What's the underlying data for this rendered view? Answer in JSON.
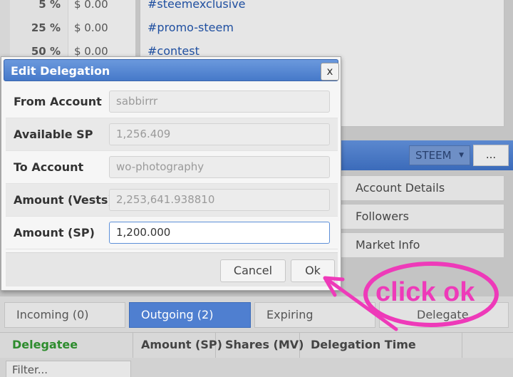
{
  "background": {
    "percent_rows": [
      {
        "pct": "5 %",
        "usd": "$ 0.00"
      },
      {
        "pct": "25 %",
        "usd": "$ 0.00"
      },
      {
        "pct": "50 %",
        "usd": "$ 0.00"
      }
    ],
    "tags": [
      "#steemexclusive",
      "#promo-steem",
      "#contest"
    ],
    "currency": {
      "selected": "STEEM",
      "more_label": "..."
    },
    "menu": [
      "Account Details",
      "Followers",
      "Market Info"
    ],
    "tabs": [
      "Incoming (0)",
      "Outgoing (2)",
      "Expiring",
      "Delegate"
    ],
    "table": {
      "headers": [
        "Delegatee",
        "Amount (SP)",
        "Shares (MV)",
        "Delegation Time"
      ],
      "filter_placeholder": "Filter..."
    }
  },
  "dialog": {
    "title": "Edit Delegation",
    "close_label": "x",
    "fields": [
      {
        "label": "From Account",
        "value": "sabbirrr"
      },
      {
        "label": "Available SP",
        "value": "1,256.409"
      },
      {
        "label": "To Account",
        "value": "wo-photography"
      },
      {
        "label": "Amount (Vests)",
        "value": "2,253,641.938810"
      },
      {
        "label": "Amount (SP)",
        "value": "1,200.000"
      }
    ],
    "cancel_label": "Cancel",
    "ok_label": "Ok"
  },
  "annotation": {
    "text": "click ok",
    "color": "#ee3ab9"
  },
  "colors": {
    "accent": "#4679c9",
    "delegatee_header": "#2d8c2d"
  }
}
